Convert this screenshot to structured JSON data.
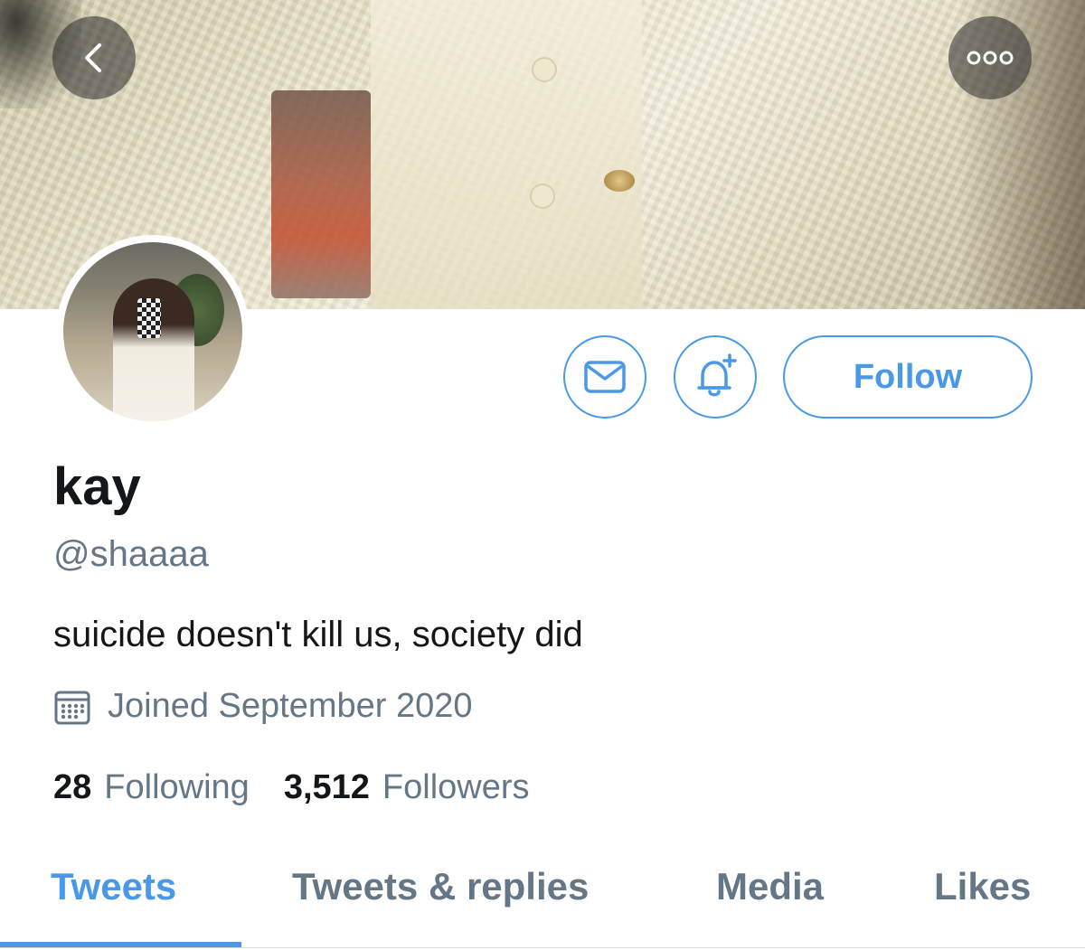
{
  "profile": {
    "name": "kay",
    "handle": "@shaaaa",
    "bio": "suicide doesn't kill us, society did",
    "joined": "Joined September 2020"
  },
  "actions": {
    "follow_label": "Follow"
  },
  "stats": {
    "following_count": "28",
    "following_label": "Following",
    "followers_count": "3,512",
    "followers_label": "Followers"
  },
  "tabs": [
    {
      "label": "Tweets",
      "active": true
    },
    {
      "label": "Tweets & replies",
      "active": false
    },
    {
      "label": "Media",
      "active": false
    },
    {
      "label": "Likes",
      "active": false
    }
  ],
  "colors": {
    "accent": "#4a99e9",
    "text_primary": "#14171a",
    "text_secondary": "#657786"
  },
  "icons": [
    "back-arrow-icon",
    "more-options-icon",
    "mail-icon",
    "notification-bell-icon",
    "calendar-icon"
  ]
}
